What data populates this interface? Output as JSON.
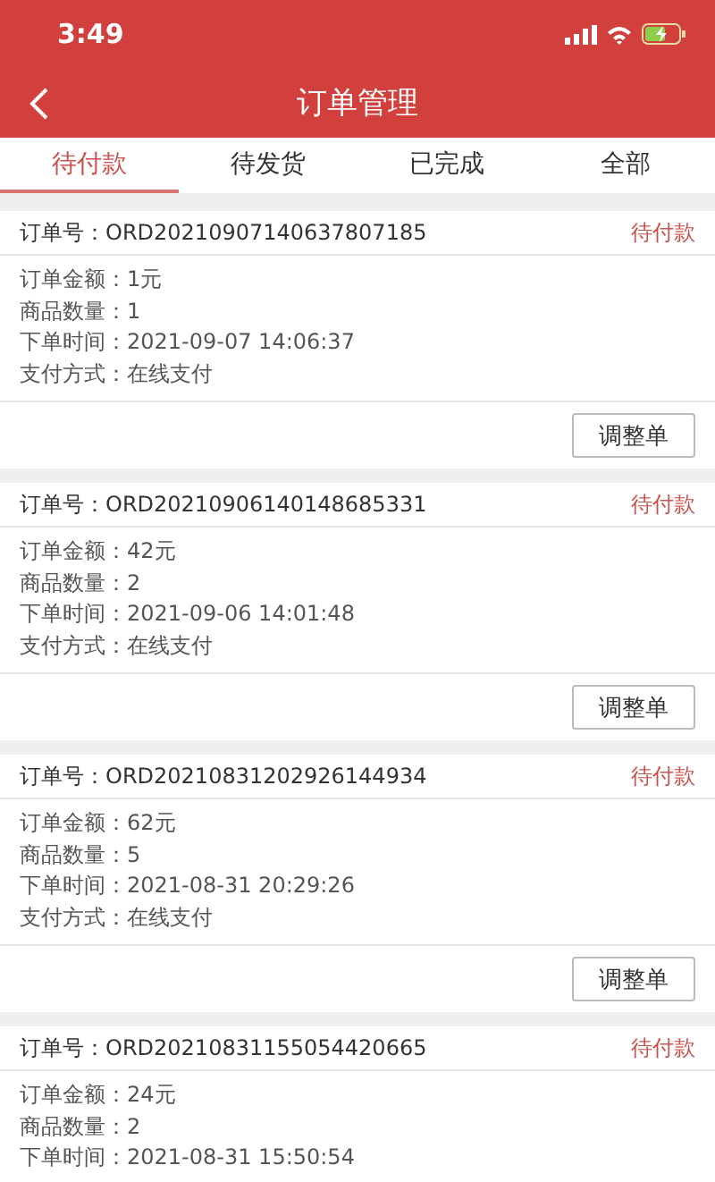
{
  "status_bar": {
    "time": "3:49"
  },
  "nav": {
    "title": "订单管理"
  },
  "tabs": [
    {
      "label": "待付款",
      "selected": true
    },
    {
      "label": "待发货",
      "selected": false
    },
    {
      "label": "已完成",
      "selected": false
    },
    {
      "label": "全部",
      "selected": false
    }
  ],
  "orders": [
    {
      "number_label": "订单号：",
      "number": "ORD20210907140637807185",
      "status": "待付款",
      "details": [
        {
          "label": "订单金额：",
          "value": "1元"
        },
        {
          "label": "商品数量：",
          "value": "1"
        },
        {
          "label": "下单时间：",
          "value": "2021-09-07 14:06:37"
        },
        {
          "label": "支付方式：",
          "value": "在线支付"
        }
      ],
      "button": "调整单"
    },
    {
      "number_label": "订单号：",
      "number": "ORD20210906140148685331",
      "status": "待付款",
      "details": [
        {
          "label": "订单金额：",
          "value": "42元"
        },
        {
          "label": "商品数量：",
          "value": "2"
        },
        {
          "label": "下单时间：",
          "value": "2021-09-06 14:01:48"
        },
        {
          "label": "支付方式：",
          "value": "在线支付"
        }
      ],
      "button": "调整单"
    },
    {
      "number_label": "订单号：",
      "number": "ORD20210831202926144934",
      "status": "待付款",
      "details": [
        {
          "label": "订单金额：",
          "value": "62元"
        },
        {
          "label": "商品数量：",
          "value": "5"
        },
        {
          "label": "下单时间：",
          "value": "2021-08-31 20:29:26"
        },
        {
          "label": "支付方式：",
          "value": "在线支付"
        }
      ],
      "button": "调整单"
    },
    {
      "number_label": "订单号：",
      "number": "ORD20210831155054420665",
      "status": "待付款",
      "details": [
        {
          "label": "订单金额：",
          "value": "24元"
        },
        {
          "label": "商品数量：",
          "value": "2"
        },
        {
          "label": "下单时间：",
          "value": "2021-08-31 15:50:54"
        }
      ]
    }
  ]
}
